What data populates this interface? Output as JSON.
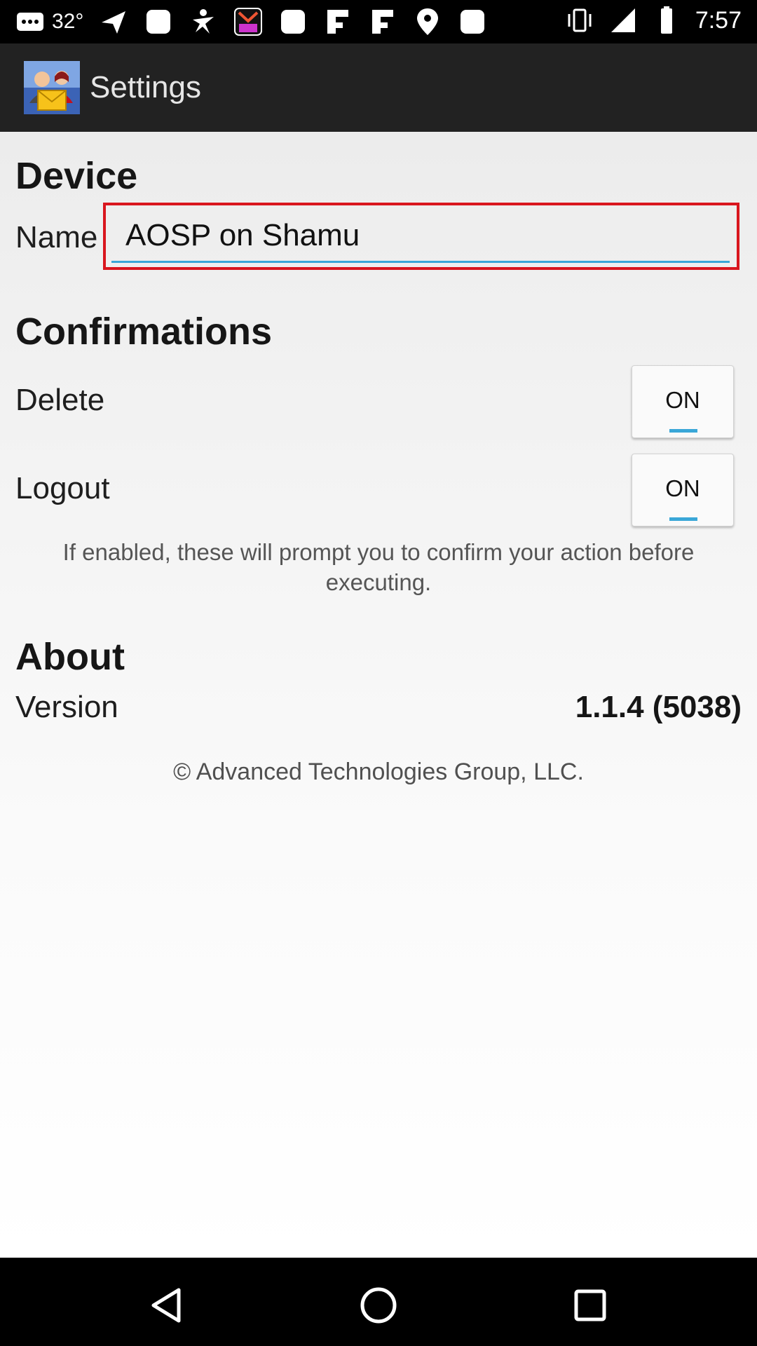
{
  "status_bar": {
    "temperature": "32°",
    "time": "7:57",
    "icons": [
      "message-icon",
      "send-icon",
      "notification-icon",
      "fitness-icon",
      "pop-app-icon",
      "notification-icon",
      "flipboard-icon",
      "flipboard-icon",
      "location-icon",
      "notification-icon",
      "vibrate-icon",
      "signal-icon",
      "battery-icon"
    ]
  },
  "app_bar": {
    "title": "Settings",
    "icon": "app-logo-icon"
  },
  "device": {
    "section_title": "Device",
    "name_label": "Name",
    "name_value": "AOSP on Shamu"
  },
  "confirmations": {
    "section_title": "Confirmations",
    "delete_label": "Delete",
    "delete_toggle": "ON",
    "logout_label": "Logout",
    "logout_toggle": "ON",
    "hint": "If enabled, these will prompt you to confirm your action before executing."
  },
  "about": {
    "section_title": "About",
    "version_label": "Version",
    "version_value": "1.1.4 (5038)",
    "copyright": "© Advanced Technologies Group, LLC."
  },
  "colors": {
    "accent": "#3aa7d8",
    "highlight": "#d9161e",
    "app_bar": "#222222"
  },
  "nav_bar": {
    "icons": [
      "back-icon",
      "home-icon",
      "recents-icon"
    ]
  }
}
